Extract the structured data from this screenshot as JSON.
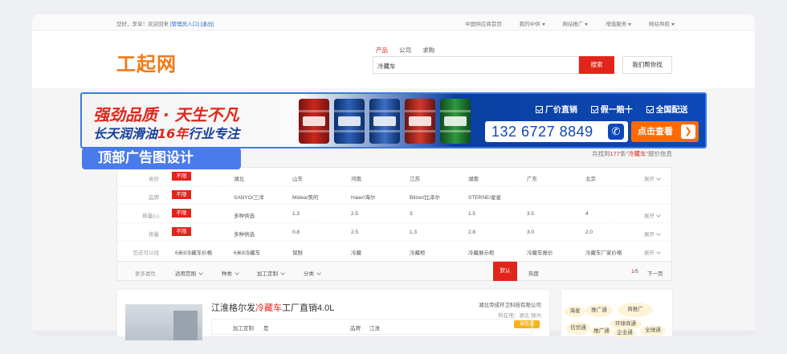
{
  "topbar": {
    "greeting": "您好，李享！欢迎回来",
    "admin_link": "[管理员入口]",
    "logout_link": "[退出]",
    "nav": [
      "中国供应商首页",
      "我的中供",
      "网站推广",
      "增值服务",
      "网站导航"
    ]
  },
  "header": {
    "logo": "工起网",
    "search_tabs": [
      "产品",
      "公司",
      "求购"
    ],
    "search_value": "冷藏车",
    "search_button": "搜索",
    "help_button": "我们帮你找"
  },
  "banner": {
    "headline": "强劲品质 · 天生不凡",
    "subline_pre": "长天润滑油",
    "subline_hl": "16年",
    "subline_post": "行业专注",
    "badges": [
      "厂价直销",
      "假一赔十",
      "全国配送"
    ],
    "phone": "132 6727 8849",
    "cta": "点击查看"
  },
  "annotation": {
    "label": "顶部广告图设计"
  },
  "results": {
    "prefix": "共找到",
    "count": "177",
    "mid": "条“",
    "keyword": "冷藏车",
    "suffix": "”报价信息"
  },
  "filters": [
    {
      "label": "省份",
      "all": "不限",
      "options": [
        "湖北",
        "山东",
        "河南",
        "江苏",
        "湖南",
        "广东",
        "北京"
      ],
      "expand": "展开"
    },
    {
      "label": "品牌",
      "all": "不限",
      "options": [
        "SANYO/三洋",
        "Midea/美的",
        "Haier/海尔",
        "Bitzer/比泽尔",
        "STERNE/星星"
      ],
      "expand": ""
    },
    {
      "label": "排量(L)",
      "all": "不限",
      "options": [
        "多种供选",
        "1.3",
        "2.5",
        "3",
        "1.5",
        "3.5",
        "4"
      ],
      "expand": "展开"
    },
    {
      "label": "排量",
      "all": "不限",
      "options": [
        "多种供选",
        "0.8",
        "2.5",
        "1.3",
        "2.8",
        "3.0",
        "2.0"
      ],
      "expand": "展开"
    },
    {
      "label": "您还可以找",
      "all": "",
      "options": [
        "6米8冷藏车价格",
        "6米8冷藏车",
        "保鲜",
        "冷藏",
        "冷藏柜",
        "冷藏展示柜",
        "冷藏车报价",
        "冷藏车厂家价格"
      ],
      "expand": "展开"
    }
  ],
  "sortbar": {
    "more": "更多属性",
    "dropdowns": [
      "适用范围",
      "种类",
      "加工定制",
      "分类"
    ],
    "default": "默认",
    "hot": "热度",
    "page_current": "1",
    "page_total": "/5",
    "next": "下一页"
  },
  "product": {
    "title_pre": "江淮格尔发",
    "title_hl": "冷藏车",
    "title_post": "工厂直销4.0L",
    "company": "湖北帝成环卫科技有限公司",
    "location": "所在地：湖北 随州",
    "year_badge": "诚信通",
    "spec_k1": "加工定制",
    "spec_v1": "是",
    "spec_k2": "品牌",
    "spec_v2": "江淮"
  },
  "side_tags": [
    "推广通",
    "商推广",
    "海星",
    "信贸通",
    "环球商通",
    "推广通",
    "企业通",
    "全球通"
  ]
}
